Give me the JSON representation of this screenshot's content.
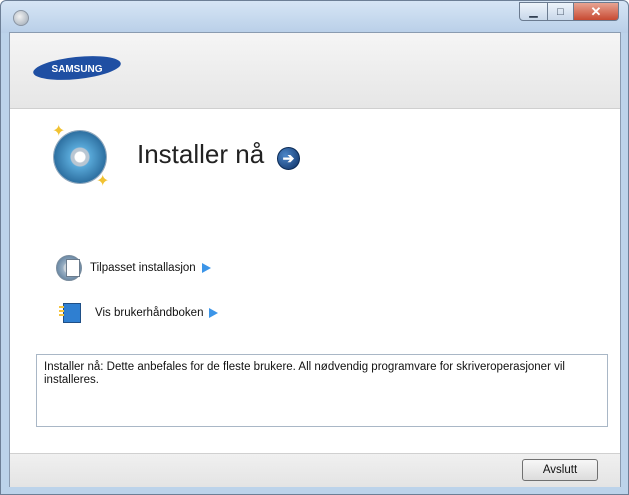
{
  "window": {
    "brand": "SAMSUNG",
    "controls": {
      "minimize_icon": "minimize-icon",
      "maximize_icon": "maximize-icon",
      "close_icon": "close-icon"
    }
  },
  "main": {
    "install_now_label": "Installer nå",
    "options": [
      {
        "label": "Tilpasset installasjon",
        "icon": "custom-install-cd-icon"
      },
      {
        "label": "Vis brukerhåndboken",
        "icon": "user-guide-book-icon"
      }
    ],
    "description": "Installer nå: Dette anbefales for de fleste brukere. All nødvendig programvare for skriveroperasjoner vil installeres."
  },
  "footer": {
    "exit_label": "Avslutt"
  },
  "colors": {
    "accent": "#3c95e8",
    "brand_blue": "#1f4fa3",
    "title_bar": "#bcd3ea"
  }
}
